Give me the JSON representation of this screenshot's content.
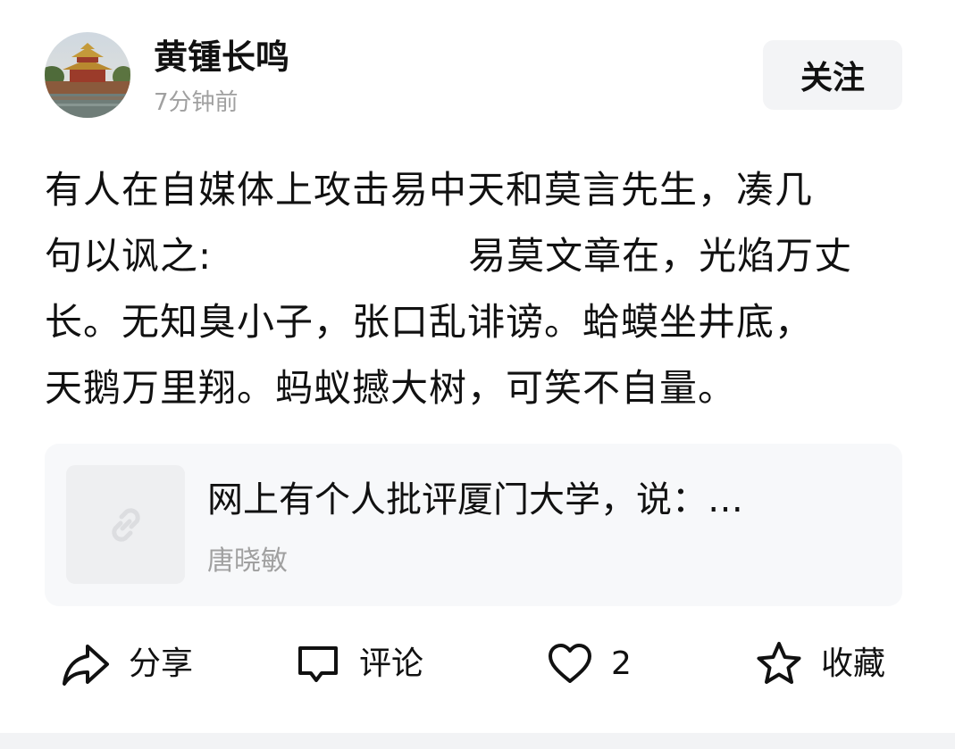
{
  "author": {
    "name": "黄锺长鸣",
    "time": "7分钟前",
    "avatar_desc": "avatar"
  },
  "follow": {
    "label": "关注"
  },
  "post": {
    "text": "有人在自媒体上攻击易中天和莫言先生，凑几\n句以讽之:                    易莫文章在，光焰万丈\n长。无知臭小子，张口乱诽谤。蛤蟆坐井底，\n天鹅万里翔。蚂蚁撼大树，可笑不自量。"
  },
  "link_card": {
    "title": "网上有个人批评厦门大学，说：…",
    "author": "唐晓敏",
    "icon": "link-icon"
  },
  "actions": {
    "share": {
      "label": "分享",
      "icon": "share-icon"
    },
    "comment": {
      "label": "评论",
      "icon": "comment-icon"
    },
    "like": {
      "label": "2",
      "icon": "heart-icon"
    },
    "favorite": {
      "label": "收藏",
      "icon": "star-icon"
    }
  },
  "colors": {
    "text": "#111111",
    "muted": "#a0a0a0",
    "button_bg": "#f3f4f6",
    "card_bg": "#f7f8fa"
  }
}
